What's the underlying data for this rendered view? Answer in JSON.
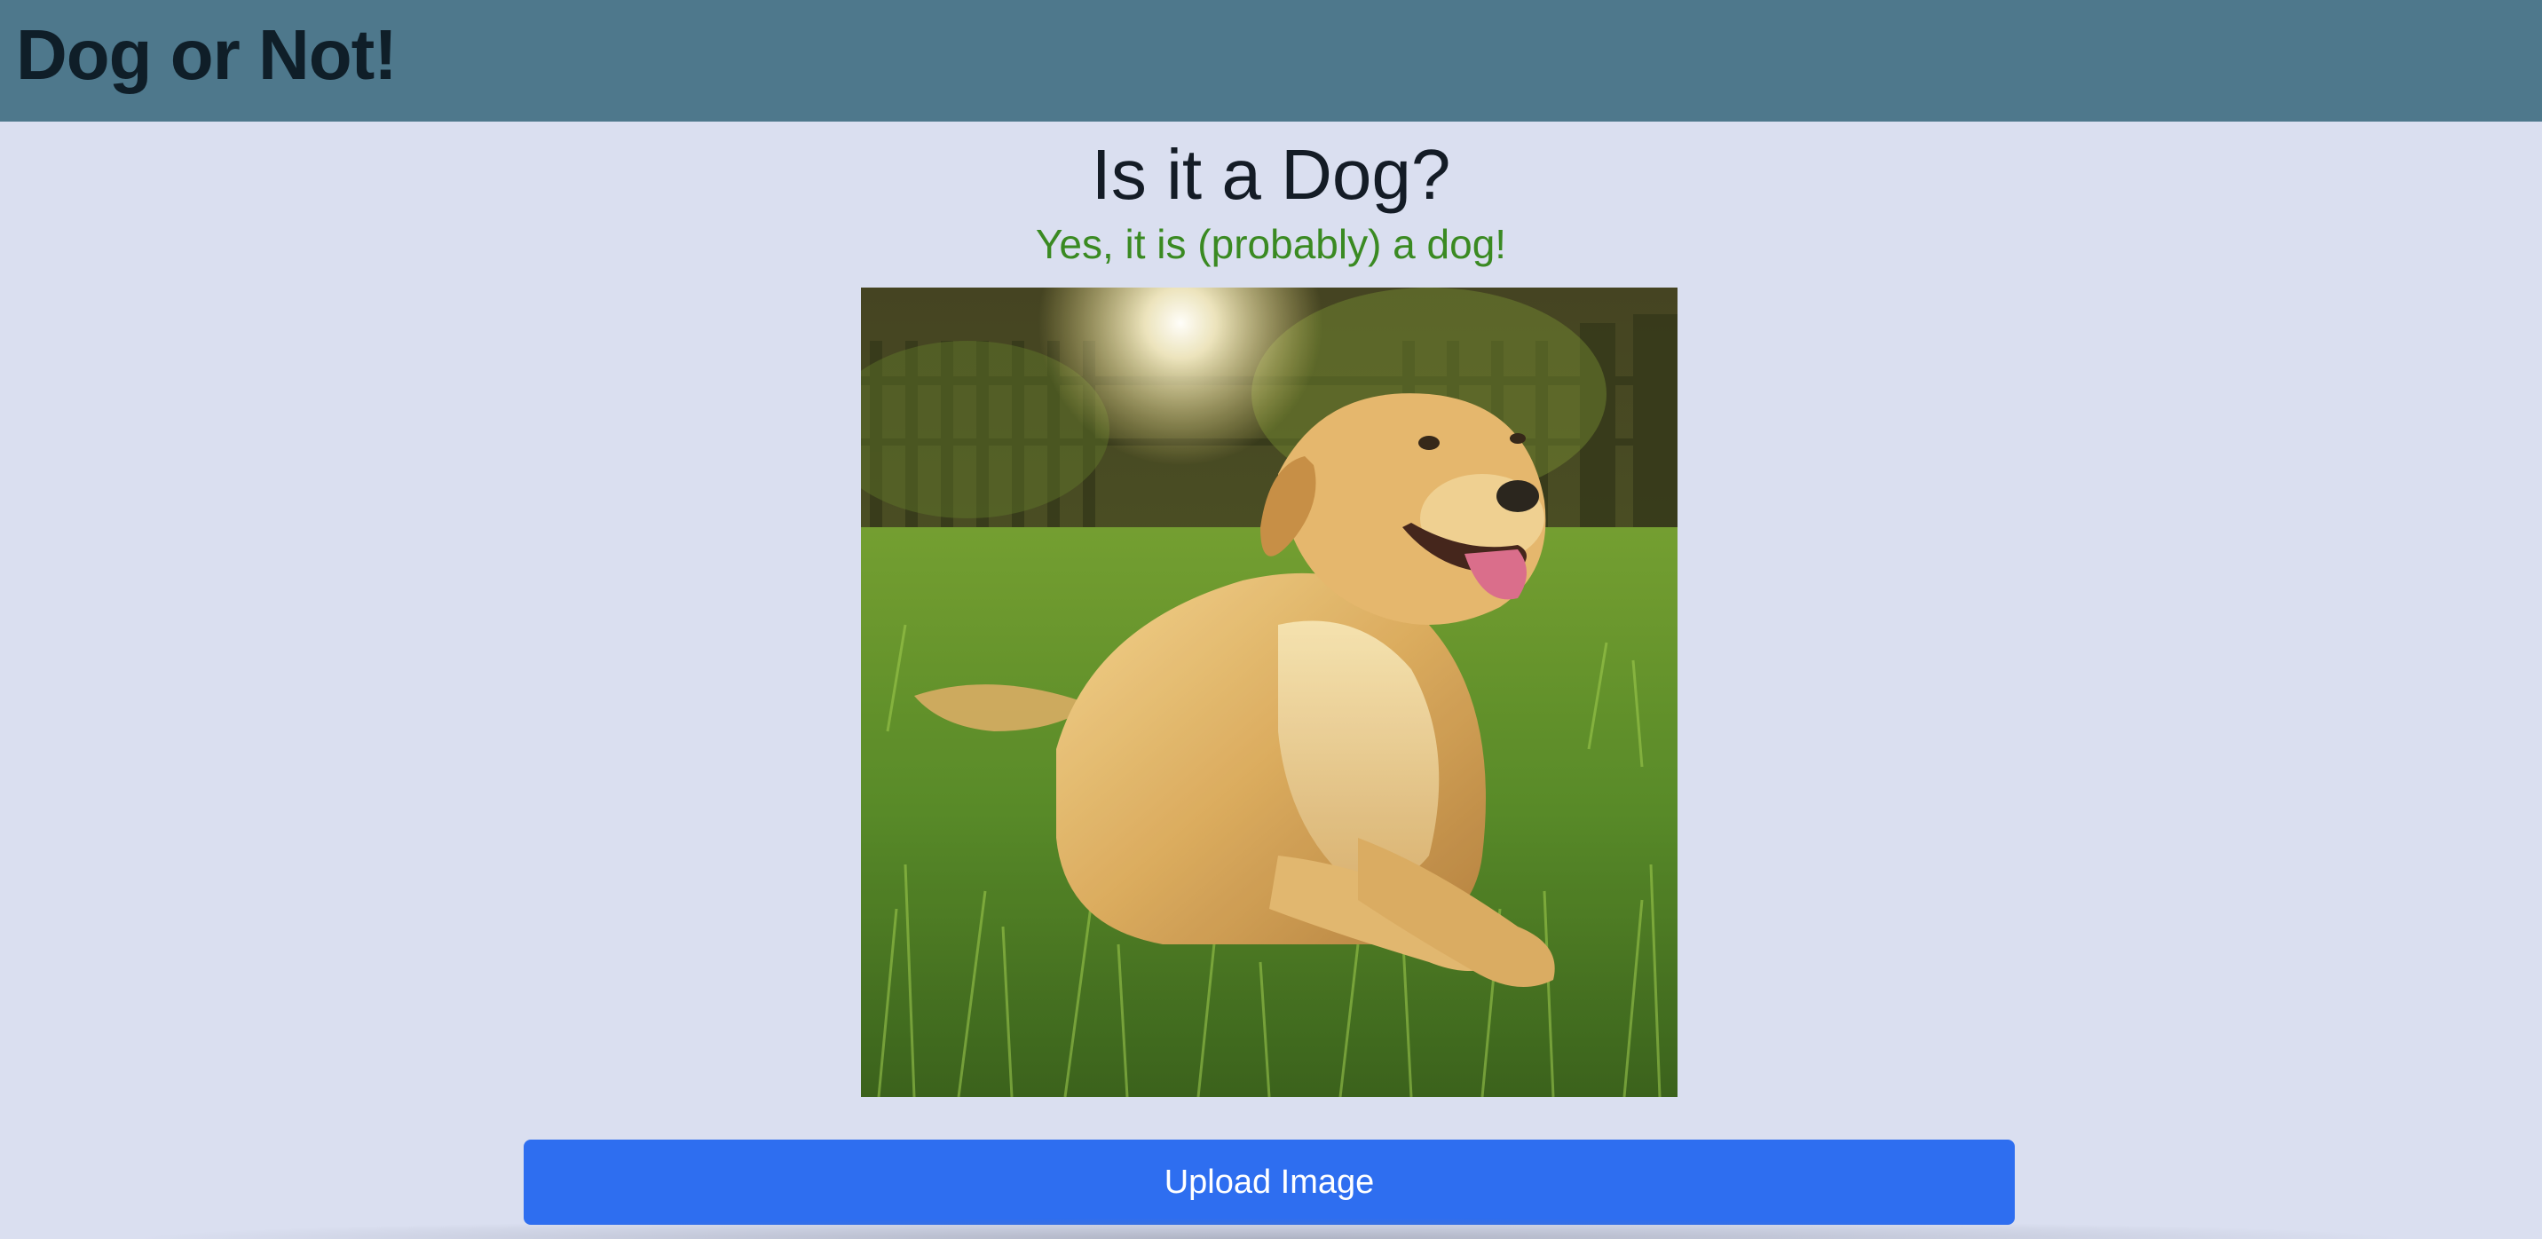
{
  "header": {
    "app_title": "Dog or Not!"
  },
  "main": {
    "heading": "Is it a Dog?",
    "result": "Yes, it is (probably) a dog!",
    "photo_alt": "Golden retriever lying in grass",
    "upload_label": "Upload Image"
  },
  "colors": {
    "header_bg": "#4e788c",
    "page_bg": "#dadff0",
    "result_green": "#3a8a22",
    "button_blue": "#2e6ef0"
  }
}
